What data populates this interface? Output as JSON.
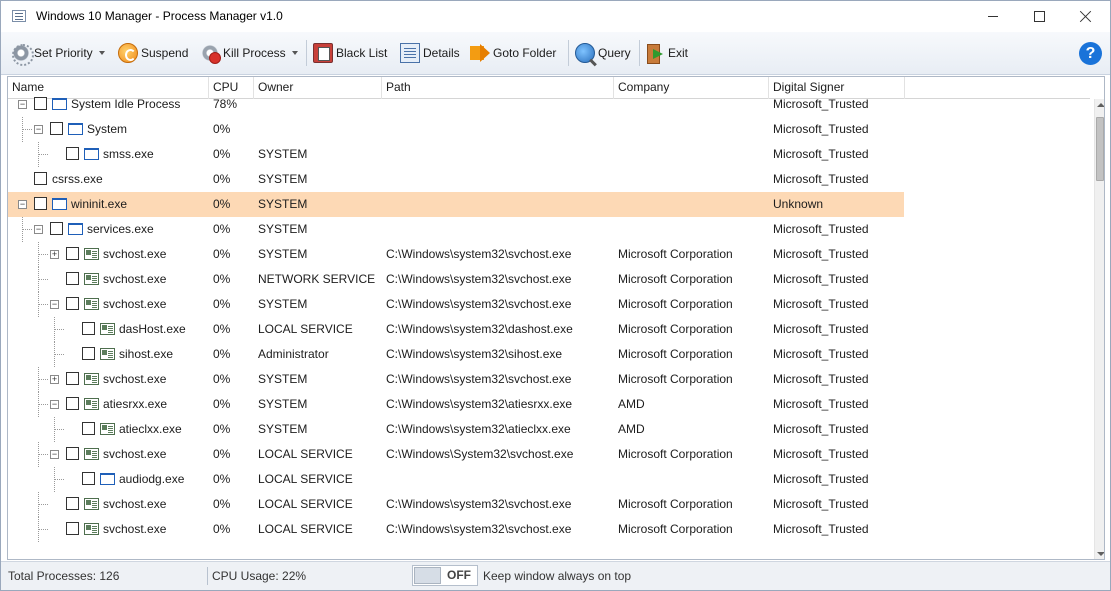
{
  "window": {
    "title": "Windows 10 Manager - Process Manager v1.0"
  },
  "toolbar": {
    "set_priority": "Set Priority",
    "suspend": "Suspend",
    "kill_process": "Kill Process",
    "black_list": "Black List",
    "details": "Details",
    "goto_folder": "Goto Folder",
    "query": "Query",
    "exit": "Exit",
    "help": "?"
  },
  "table": {
    "columns": [
      "Name",
      "CPU",
      "Owner",
      "Path",
      "Company",
      "Digital Signer"
    ],
    "rows": [
      {
        "name": "System Idle Process",
        "cpu": "78%",
        "owner": "",
        "path": "",
        "company": "",
        "signer": "Microsoft_Trusted",
        "depth": 0,
        "expander": "minus",
        "icon": "window-icon",
        "highlight": false
      },
      {
        "name": "System",
        "cpu": "0%",
        "owner": "",
        "path": "",
        "company": "",
        "signer": "Microsoft_Trusted",
        "depth": 1,
        "expander": "minus",
        "icon": "window-icon",
        "highlight": false
      },
      {
        "name": "smss.exe",
        "cpu": "0%",
        "owner": "SYSTEM",
        "path": "",
        "company": "",
        "signer": "Microsoft_Trusted",
        "depth": 2,
        "expander": "",
        "icon": "window-icon",
        "highlight": false
      },
      {
        "name": "csrss.exe",
        "cpu": "0%",
        "owner": "SYSTEM",
        "path": "",
        "company": "",
        "signer": "Microsoft_Trusted",
        "depth": 0,
        "expander": "",
        "icon": "",
        "highlight": false
      },
      {
        "name": "wininit.exe",
        "cpu": "0%",
        "owner": "SYSTEM",
        "path": "",
        "company": "",
        "signer": "Unknown",
        "depth": 0,
        "expander": "minus",
        "icon": "window-icon",
        "highlight": true
      },
      {
        "name": "services.exe",
        "cpu": "0%",
        "owner": "SYSTEM",
        "path": "",
        "company": "",
        "signer": "Microsoft_Trusted",
        "depth": 1,
        "expander": "minus",
        "icon": "window-icon",
        "highlight": false
      },
      {
        "name": "svchost.exe",
        "cpu": "0%",
        "owner": "SYSTEM",
        "path": "C:\\Windows\\system32\\svchost.exe",
        "company": "Microsoft Corporation",
        "signer": "Microsoft_Trusted",
        "depth": 2,
        "expander": "plus",
        "icon": "service-icon",
        "highlight": false
      },
      {
        "name": "svchost.exe",
        "cpu": "0%",
        "owner": "NETWORK SERVICE",
        "path": "C:\\Windows\\system32\\svchost.exe",
        "company": "Microsoft Corporation",
        "signer": "Microsoft_Trusted",
        "depth": 2,
        "expander": "",
        "icon": "service-icon",
        "highlight": false
      },
      {
        "name": "svchost.exe",
        "cpu": "0%",
        "owner": "SYSTEM",
        "path": "C:\\Windows\\system32\\svchost.exe",
        "company": "Microsoft Corporation",
        "signer": "Microsoft_Trusted",
        "depth": 2,
        "expander": "minus",
        "icon": "service-icon",
        "highlight": false
      },
      {
        "name": "dasHost.exe",
        "cpu": "0%",
        "owner": "LOCAL SERVICE",
        "path": "C:\\Windows\\system32\\dashost.exe",
        "company": "Microsoft Corporation",
        "signer": "Microsoft_Trusted",
        "depth": 3,
        "expander": "",
        "icon": "service-icon",
        "highlight": false
      },
      {
        "name": "sihost.exe",
        "cpu": "0%",
        "owner": "Administrator",
        "path": "C:\\Windows\\system32\\sihost.exe",
        "company": "Microsoft Corporation",
        "signer": "Microsoft_Trusted",
        "depth": 3,
        "expander": "",
        "icon": "service-icon",
        "highlight": false
      },
      {
        "name": "svchost.exe",
        "cpu": "0%",
        "owner": "SYSTEM",
        "path": "C:\\Windows\\system32\\svchost.exe",
        "company": "Microsoft Corporation",
        "signer": "Microsoft_Trusted",
        "depth": 2,
        "expander": "plus",
        "icon": "service-icon",
        "highlight": false
      },
      {
        "name": "atiesrxx.exe",
        "cpu": "0%",
        "owner": "SYSTEM",
        "path": "C:\\Windows\\system32\\atiesrxx.exe",
        "company": "AMD",
        "signer": "Microsoft_Trusted",
        "depth": 2,
        "expander": "minus",
        "icon": "service-icon",
        "highlight": false
      },
      {
        "name": "atieclxx.exe",
        "cpu": "0%",
        "owner": "SYSTEM",
        "path": "C:\\Windows\\system32\\atieclxx.exe",
        "company": "AMD",
        "signer": "Microsoft_Trusted",
        "depth": 3,
        "expander": "",
        "icon": "service-icon",
        "highlight": false
      },
      {
        "name": "svchost.exe",
        "cpu": "0%",
        "owner": "LOCAL SERVICE",
        "path": "C:\\Windows\\System32\\svchost.exe",
        "company": "Microsoft Corporation",
        "signer": "Microsoft_Trusted",
        "depth": 2,
        "expander": "minus",
        "icon": "service-icon",
        "highlight": false
      },
      {
        "name": "audiodg.exe",
        "cpu": "0%",
        "owner": "LOCAL SERVICE",
        "path": "",
        "company": "",
        "signer": "Microsoft_Trusted",
        "depth": 3,
        "expander": "",
        "icon": "window-icon",
        "highlight": false
      },
      {
        "name": "svchost.exe",
        "cpu": "0%",
        "owner": "LOCAL SERVICE",
        "path": "C:\\Windows\\system32\\svchost.exe",
        "company": "Microsoft Corporation",
        "signer": "Microsoft_Trusted",
        "depth": 2,
        "expander": "",
        "icon": "service-icon",
        "highlight": false
      },
      {
        "name": "svchost.exe",
        "cpu": "0%",
        "owner": "LOCAL SERVICE",
        "path": "C:\\Windows\\system32\\svchost.exe",
        "company": "Microsoft Corporation",
        "signer": "Microsoft_Trusted",
        "depth": 2,
        "expander": "",
        "icon": "service-icon",
        "highlight": false
      }
    ]
  },
  "status": {
    "total_processes": "Total Processes: 126",
    "cpu_usage": "CPU Usage: 22%",
    "toggle_state": "OFF",
    "toggle_label": "Keep window always on top"
  },
  "colors": {
    "highlight_row": "#fdd9b5",
    "help_blue": "#1a73d9"
  }
}
